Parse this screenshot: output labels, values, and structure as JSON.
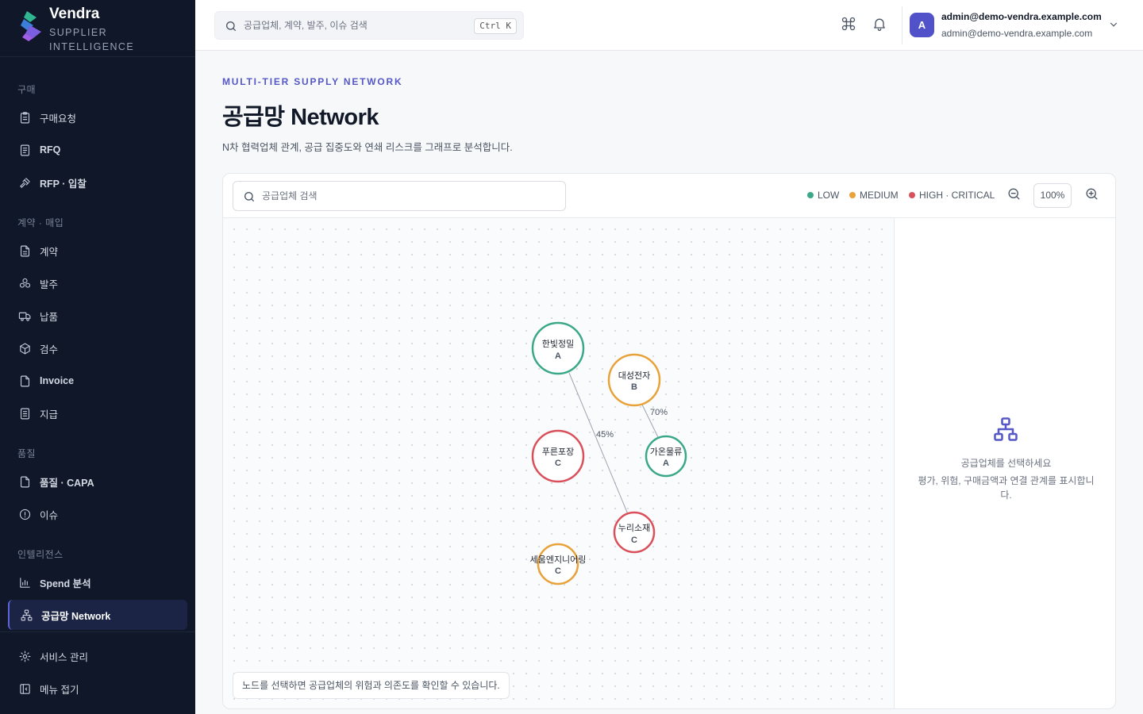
{
  "brand": {
    "name": "Vendra",
    "subtitle": "SUPPLIER INTELLIGENCE"
  },
  "sidebar": {
    "sections": [
      {
        "label": "구매",
        "items": [
          {
            "label": "구매요청",
            "icon": "clipboard-icon"
          },
          {
            "label": "RFQ",
            "icon": "document-list-icon"
          },
          {
            "label": "RFP · 입찰",
            "icon": "gavel-icon"
          }
        ]
      },
      {
        "label": "계약 · 매입",
        "items": [
          {
            "label": "계약",
            "icon": "contract-icon"
          },
          {
            "label": "발주",
            "icon": "boxes-icon"
          },
          {
            "label": "납품",
            "icon": "truck-icon"
          },
          {
            "label": "검수",
            "icon": "package-icon"
          },
          {
            "label": "Invoice",
            "icon": "invoice-icon"
          },
          {
            "label": "지급",
            "icon": "receipt-icon"
          }
        ]
      },
      {
        "label": "품질",
        "items": [
          {
            "label": "품질 · CAPA",
            "icon": "file-check-icon"
          },
          {
            "label": "이슈",
            "icon": "alert-circle-icon"
          }
        ]
      },
      {
        "label": "인텔리전스",
        "items": [
          {
            "label": "Spend 분석",
            "icon": "bar-chart-icon"
          },
          {
            "label": "공급망 Network",
            "icon": "network-icon",
            "active": true
          }
        ]
      }
    ],
    "footer": [
      {
        "label": "서비스 관리",
        "icon": "gear-icon"
      },
      {
        "label": "메뉴 접기",
        "icon": "collapse-sidebar-icon"
      }
    ]
  },
  "topbar": {
    "search_placeholder": "공급업체, 계약, 발주, 이슈 검색",
    "shortcut": "Ctrl K",
    "user_name": "admin@demo-vendra.example.com",
    "user_email": "admin@demo-vendra.example.com",
    "avatar_initial": "A"
  },
  "page": {
    "eyebrow": "MULTI-TIER SUPPLY NETWORK",
    "title": "공급망 Network",
    "description": "N차 협력업체 관계, 공급 집중도와 연쇄 리스크를 그래프로 분석합니다."
  },
  "network": {
    "search_placeholder": "공급업체 검색",
    "legend": [
      {
        "label": "LOW",
        "color": "#3aa889"
      },
      {
        "label": "MEDIUM",
        "color": "#e8a23a"
      },
      {
        "label": "HIGH · CRITICAL",
        "color": "#d9505a"
      }
    ],
    "zoom": "100%",
    "nodes": [
      {
        "id": "hanbit",
        "name": "한빛정밀",
        "grade": "A",
        "risk": "low"
      },
      {
        "id": "daesung",
        "name": "대성전자",
        "grade": "B",
        "risk": "medium"
      },
      {
        "id": "pureun",
        "name": "푸른포장",
        "grade": "C",
        "risk": "high"
      },
      {
        "id": "gaon",
        "name": "가온물류",
        "grade": "A",
        "risk": "low"
      },
      {
        "id": "nuri",
        "name": "누리소재",
        "grade": "C",
        "risk": "high"
      },
      {
        "id": "saeum",
        "name": "세움엔지니어링",
        "grade": "C",
        "risk": "medium"
      }
    ],
    "edges": [
      {
        "from": "hanbit",
        "to": "nuri",
        "label": "45%"
      },
      {
        "from": "daesung",
        "to": "gaon",
        "label": "70%"
      }
    ],
    "hint": "노드를 선택하면 공급업체의 위험과 의존도를 확인할 수 있습니다."
  },
  "detail": {
    "empty_title": "공급업체를 선택하세요",
    "empty_desc": "평가, 위험, 구매금액과 연결 관계를 표시합니다."
  },
  "colors": {
    "accent": "#5558c6",
    "sidebar_bg": "#0f1729",
    "low": "#3aa889",
    "medium": "#e8a23a",
    "high": "#d9505a"
  }
}
